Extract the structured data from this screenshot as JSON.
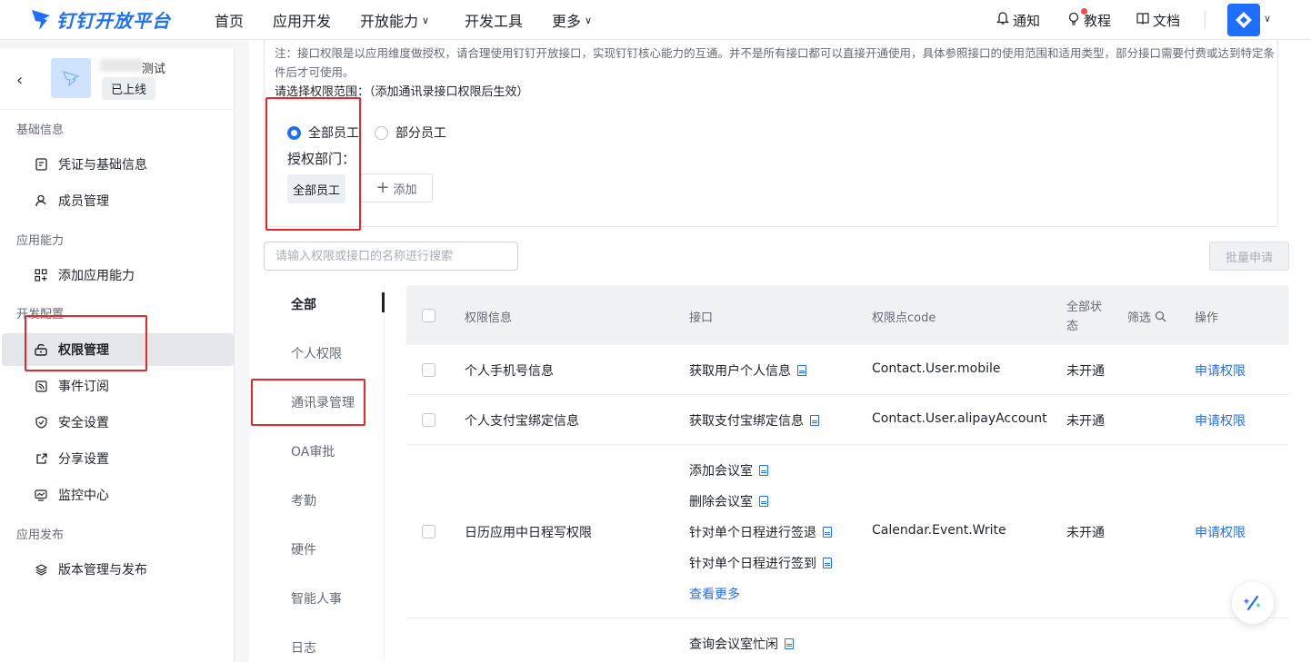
{
  "brand": {
    "name": "钉钉开放平台",
    "color": "#1f6fff"
  },
  "nav": [
    {
      "label": "首页",
      "has_caret": false
    },
    {
      "label": "应用开发",
      "has_caret": false
    },
    {
      "label": "开放能力",
      "has_caret": true
    },
    {
      "label": "开发工具",
      "has_caret": false
    },
    {
      "label": "更多",
      "has_caret": true
    }
  ],
  "top_right": {
    "notify": "通知",
    "tutorial": "教程",
    "docs": "文档"
  },
  "app": {
    "name_suffix": "测试",
    "status": "已上线"
  },
  "sidebar": {
    "groups": [
      {
        "label": "基础信息",
        "items": [
          {
            "label": "凭证与基础信息",
            "icon": "credential-icon"
          },
          {
            "label": "成员管理",
            "icon": "user-icon"
          }
        ]
      },
      {
        "label": "应用能力",
        "items": [
          {
            "label": "添加应用能力",
            "icon": "grid-plus-icon"
          }
        ]
      },
      {
        "label": "开发配置",
        "items": [
          {
            "label": "权限管理",
            "icon": "lock-icon",
            "active": true
          },
          {
            "label": "事件订阅",
            "icon": "rss-icon"
          },
          {
            "label": "安全设置",
            "icon": "shield-icon"
          },
          {
            "label": "分享设置",
            "icon": "share-icon"
          },
          {
            "label": "监控中心",
            "icon": "monitor-icon"
          }
        ]
      },
      {
        "label": "应用发布",
        "items": [
          {
            "label": "版本管理与发布",
            "icon": "layers-icon"
          }
        ]
      }
    ]
  },
  "notice": {
    "text": "注：接口权限是以应用维度做授权，请合理使用钉钉开放接口，实现钉钉核心能力的互通。并不是所有接口都可以直接开通使用，具体参照接口的使用范围和适用类型，部分接口需要付费或达到特定条件后才可使用。",
    "scope_label": "请选择权限范围：（添加通讯录接口权限后生效）",
    "radio_all": "全部员工",
    "radio_part": "部分员工",
    "auth_dept_label": "授权部门：",
    "dept_tag": "全部员工",
    "add_label": "添加"
  },
  "search": {
    "placeholder": "请输入权限或接口的名称进行搜索",
    "value": ""
  },
  "batch_button": "批量申请",
  "categories": [
    "全部",
    "个人权限",
    "通讯录管理",
    "OA审批",
    "考勤",
    "硬件",
    "智能人事",
    "日志"
  ],
  "table": {
    "headers": {
      "info": "权限信息",
      "api": "接口",
      "code": "权限点code",
      "status_line1": "全部状",
      "status_line2": "态",
      "filter": "筛选",
      "action": "操作"
    },
    "rows": [
      {
        "info": "个人手机号信息",
        "apis": [
          "获取用户个人信息"
        ],
        "code": "Contact.User.mobile",
        "status": "未开通",
        "action": "申请权限"
      },
      {
        "info": "个人支付宝绑定信息",
        "apis": [
          "获取支付宝绑定信息"
        ],
        "code": "Contact.User.alipayAccount",
        "status": "未开通",
        "action": "申请权限"
      },
      {
        "info": "日历应用中日程写权限",
        "apis": [
          "添加会议室",
          "删除会议室",
          "针对单个日程进行签退",
          "针对单个日程进行签到"
        ],
        "more": "查看更多",
        "code": "Calendar.Event.Write",
        "status": "未开通",
        "action": "申请权限"
      },
      {
        "info": "",
        "apis": [
          "查询会议室忙闲"
        ],
        "code": "",
        "status": "",
        "action": ""
      }
    ]
  },
  "annotation_color": "#e8262b"
}
